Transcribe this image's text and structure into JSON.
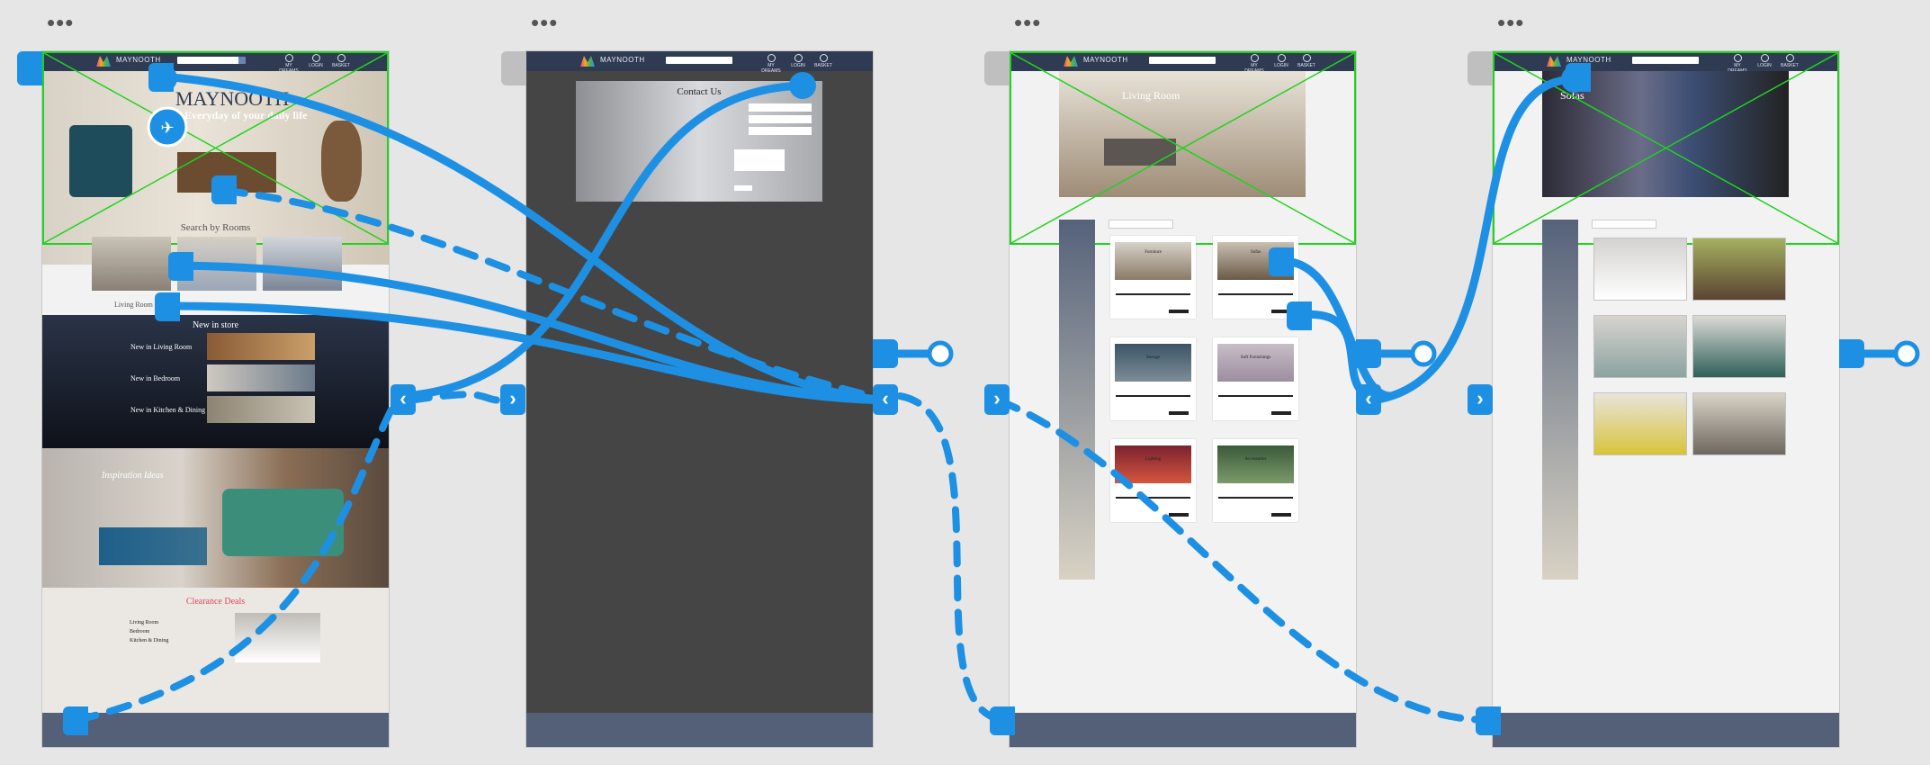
{
  "global": {
    "logo": "MAYNOOTH",
    "nav": {
      "account": "MY DREAMS",
      "login": "LOGIN",
      "basket": "BASKET"
    }
  },
  "home": {
    "hero_logo": "MAYNOOTH",
    "hero_tagline": "Everyday of your daily life",
    "search_by_rooms": "Search by Rooms",
    "living_room_label": "Living Room",
    "new_in_store": "New in store",
    "new_items": [
      "New in Living Room",
      "New in Bedroom",
      "New in Kitchen & Dining"
    ],
    "inspiration": "Inspiration Ideas",
    "clearance": "Clearance Deals",
    "clearance_rooms": [
      "Living Room",
      "Bedroom",
      "Kitchen & Dining"
    ]
  },
  "contact": {
    "title": "Contact Us"
  },
  "category": {
    "title": "Living Room",
    "cards": [
      "Furniture",
      "Sofas",
      "Storage",
      "Soft Furnishings",
      "Lighting",
      "Accessories"
    ]
  },
  "sofas": {
    "title": "Sofas"
  },
  "colors": {
    "accent": "#1e90e4",
    "topbar": "#2f3b52",
    "footer": "#536077",
    "placeholder": "#1fd31f",
    "clearance": "#e0455a"
  }
}
